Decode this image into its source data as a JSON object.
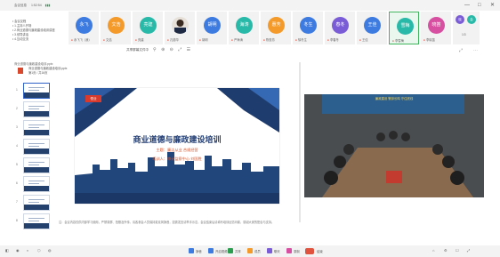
{
  "titlebar": {
    "meeting_id": "会议信息",
    "time": "1:52:54",
    "signal": "▮▮▮",
    "window_controls": [
      "—",
      "□",
      "✕"
    ]
  },
  "notes": [
    "• 会议议程",
    "• 1.主持人开场",
    "• 2.商业道德与廉政建设培训讲座",
    "• 3.领导讲话",
    "• 4.互动交流"
  ],
  "participants": [
    {
      "avatar": "永飞",
      "name": "永飞飞（我）",
      "color": "#3d7be0",
      "selected": false
    },
    {
      "avatar": "文浩",
      "name": "文浩",
      "color": "#f39a2b",
      "selected": false
    },
    {
      "avatar": "亮建",
      "name": "亮建",
      "color": "#29b9a8",
      "selected": false
    },
    {
      "avatar": "",
      "name": "孔德华",
      "color": "#e6e0d8",
      "selected": false,
      "photo": true
    },
    {
      "avatar": "胡明",
      "name": "胡明",
      "color": "#3d7be0",
      "selected": false
    },
    {
      "avatar": "海涛",
      "name": "严海涛",
      "color": "#29b9a8",
      "selected": false
    },
    {
      "avatar": "惠芳",
      "name": "陈惠芳",
      "color": "#f39a2b",
      "selected": false
    },
    {
      "avatar": "冬生",
      "name": "徐冬生",
      "color": "#3d7be0",
      "selected": false
    },
    {
      "avatar": "春冬",
      "name": "李春冬",
      "color": "#7a5cd6",
      "selected": false
    },
    {
      "avatar": "王佳",
      "name": "王佳",
      "color": "#3d7be0",
      "selected": false
    },
    {
      "avatar": "雪梅",
      "name": "李雪梅",
      "color": "#29b9a8",
      "selected": true
    },
    {
      "avatar": "晓笛",
      "name": "李晓笛",
      "color": "#d64fa0",
      "selected": false
    }
  ],
  "extra_participants": {
    "a": "晓",
    "b": "会",
    "count": "1/3"
  },
  "share": {
    "title": "共享屏幕文件中",
    "tools": [
      "⚲",
      "⊕",
      "⊖",
      "⤢",
      "☰"
    ]
  },
  "doc": {
    "header": "商业道德与廉政建设培训.pptx",
    "file_name": "商业道德与廉政建设培训.pptx",
    "file_meta": "第1页 / 共16页"
  },
  "thumbs": [
    {
      "no": "1"
    },
    {
      "no": "2"
    },
    {
      "no": "3"
    },
    {
      "no": "4"
    },
    {
      "no": "5"
    },
    {
      "no": "6"
    },
    {
      "no": "7"
    },
    {
      "no": "8"
    }
  ],
  "slide": {
    "logo": "恒业",
    "title": "商业道德与廉政建设培训",
    "subtitle": "主题：廉洁从业 合规经营",
    "trainer": "培训人：审计监察中心 刘国胜"
  },
  "caption": "注：会议内容仅供内部学习使用，严禁录屏、拍照及外传。请各参会人员保持麦克风静音，如需发言请举手示意，会议结束后请填写培训反馈问卷，感谢大家的配合与支持。",
  "video": {
    "banner": "廉政建设 警钟长鸣 守住底线"
  },
  "taskbar": {
    "left_icons": [
      "◧",
      "◉",
      "◐",
      "⬡",
      "◍"
    ],
    "items": [
      {
        "label": "静音",
        "color": "#3d7be0"
      },
      {
        "label": "开启视频",
        "color": "#3d7be0"
      },
      {
        "label": "共享",
        "color": "#2a9d4f"
      },
      {
        "label": "成员",
        "color": "#f39a2b"
      },
      {
        "label": "聊天",
        "color": "#7a5cd6"
      },
      {
        "label": "录制",
        "color": "#d64fa0"
      }
    ],
    "leave": "结束",
    "right": [
      "⌂",
      "⚙",
      "☐",
      "⤢"
    ]
  }
}
